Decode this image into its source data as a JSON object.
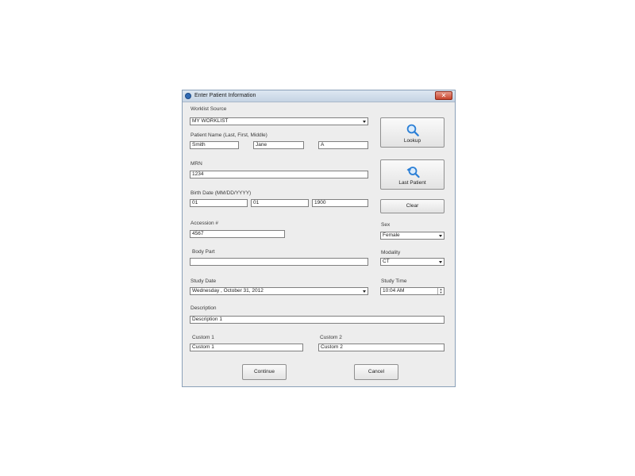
{
  "window": {
    "title": "Enter Patient Information",
    "close_glyph": "✕"
  },
  "worklist": {
    "label": "Worklist Source",
    "value": "MY WORKLIST"
  },
  "patient_name": {
    "label": "Patient Name (Last, First, Middle)",
    "last": "Smith",
    "first": "Jane",
    "middle": "A"
  },
  "mrn": {
    "label": "MRN",
    "value": "1234"
  },
  "birth_date": {
    "label": "Birth Date (MM/DD/YYYY)",
    "month": "01",
    "day": "01",
    "year": "1900"
  },
  "accession": {
    "label": "Accession #",
    "value": "4567"
  },
  "sex": {
    "label": "Sex",
    "value": "Female"
  },
  "body_part": {
    "label": "Body Part",
    "value": ""
  },
  "modality": {
    "label": "Modality",
    "value": "CT"
  },
  "study_date": {
    "label": "Study Date",
    "value": "Wednesday , October   31, 2012"
  },
  "study_time": {
    "label": "Study Time",
    "value": "10:04 AM"
  },
  "description": {
    "label": "Description",
    "value": "Description 1"
  },
  "custom1": {
    "label": "Custom 1",
    "value": "Custom 1"
  },
  "custom2": {
    "label": "Custom 2",
    "value": "Custom 2"
  },
  "buttons": {
    "lookup": "Lookup",
    "last_patient": "Last Patient",
    "clear": "Clear",
    "continue": "Continue",
    "cancel": "Cancel"
  },
  "icons": {
    "lookup": "magnifier-icon",
    "last_patient": "magnifier-back-arrow-icon"
  },
  "colors": {
    "icon_blue": "#2b7fd6",
    "title_icon": "#2f69b3",
    "close_red": "#c7442d"
  }
}
